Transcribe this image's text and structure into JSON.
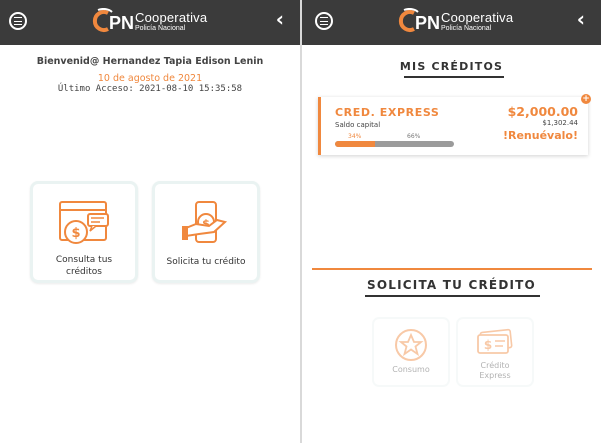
{
  "brand": {
    "line1": "Cooperativa",
    "line2": "Policía Nacional",
    "accent": "#f0883e",
    "header_bg": "#3b3b3b"
  },
  "header": {
    "back_glyph": "‹"
  },
  "left": {
    "welcome": "Bienvenid@ Hernandez Tapia Edison Lenin",
    "date": "10 de agosto de 2021",
    "last_access": "Último Acceso: 2021-08-10 15:35:58",
    "cards": [
      {
        "label_line1": "Consulta tus",
        "label_line2": "créditos",
        "icon": "credit-report-icon"
      },
      {
        "label": "Solicita tu crédito",
        "icon": "money-hand-icon"
      }
    ]
  },
  "right": {
    "mis_title": "MIS CRÉDITOS",
    "credit": {
      "name": "CRED. EXPRESS",
      "sub": "Saldo capital",
      "amount": "$2,000.00",
      "capital": "$1,302.44",
      "renew": "!Renuévalo!",
      "paid_pct": 34,
      "paid_label": "34%",
      "remaining_label": "66%",
      "plus": "+"
    },
    "sol_title": "SOLICITA TU CRÉDITO",
    "options": [
      {
        "label": "Consumo",
        "icon": "star-coin-icon"
      },
      {
        "label_line1": "Crédito",
        "label_line2": "Express",
        "icon": "banknote-icon"
      }
    ]
  }
}
